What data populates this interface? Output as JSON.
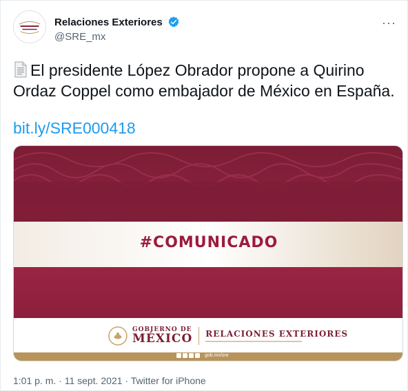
{
  "account": {
    "display_name": "Relaciones Exteriores",
    "handle": "@SRE_mx",
    "verified": true,
    "avatar_text_line1": "RELACIONES",
    "avatar_text_line2": "EXTERIORES"
  },
  "menu": {
    "more_label": "···"
  },
  "tweet": {
    "emoji_icon": "page-facing-up-icon",
    "text": "El presidente López Obrador propone a Quirino Ordaz Coppel como embajador de México en España.",
    "link": "bit.ly/SRE000418"
  },
  "card": {
    "hashtag": "#COMUNICADO",
    "gobierno_small": "GOBIERNO DE",
    "gobierno_big": "MÉXICO",
    "dependency": "RELACIONES EXTERIORES",
    "social_url": "gob.mx/sre"
  },
  "meta": {
    "time": "1:01 p. m.",
    "separator": " · ",
    "date": "11 sept. 2021",
    "source": "Twitter for iPhone"
  },
  "colors": {
    "link": "#1d9bf0",
    "secondary_text": "#536471",
    "verified": "#1d9bf0",
    "brand_maroon": "#9b1c3e",
    "brand_gold": "#b8935a"
  }
}
